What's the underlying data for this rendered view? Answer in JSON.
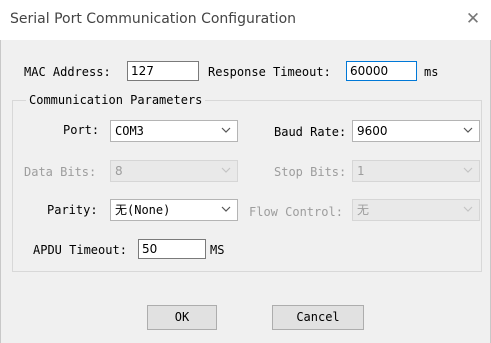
{
  "window": {
    "title": "Serial Port Communication Configuration",
    "close_icon": "close-icon"
  },
  "mac": {
    "label": "MAC Address:",
    "value": "127"
  },
  "response_timeout": {
    "label": "Response Timeout:",
    "value": "60000",
    "unit": "ms"
  },
  "group": {
    "legend": "Communication Parameters"
  },
  "port": {
    "label": "Port:",
    "value": "COM3"
  },
  "baud_rate": {
    "label": "Baud Rate:",
    "value": "9600"
  },
  "data_bits": {
    "label": "Data Bits:",
    "value": "8",
    "enabled": false
  },
  "stop_bits": {
    "label": "Stop Bits:",
    "value": "1",
    "enabled": false
  },
  "parity": {
    "label": "Parity:",
    "value": "无(None)"
  },
  "flow_control": {
    "label": "Flow Control:",
    "value": "无",
    "enabled": false
  },
  "apdu_timeout": {
    "label": "APDU Timeout:",
    "value": "50",
    "unit": "MS"
  },
  "buttons": {
    "ok": "OK",
    "cancel": "Cancel"
  }
}
